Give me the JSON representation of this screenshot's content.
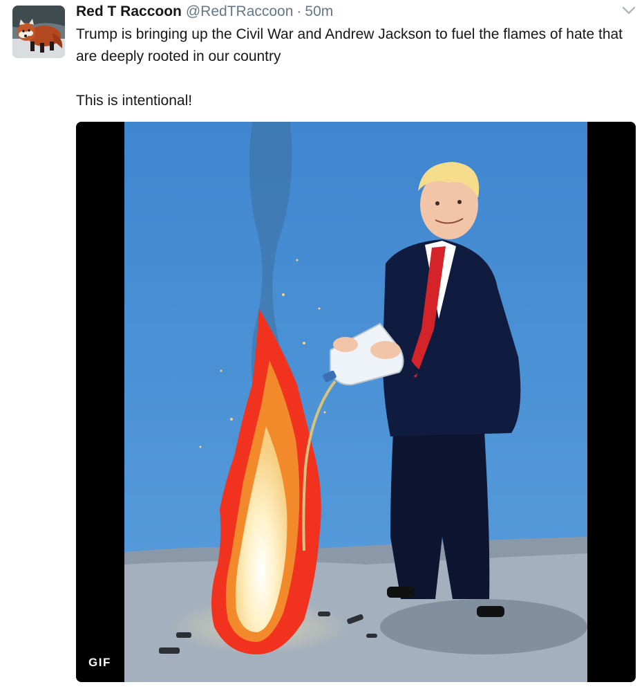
{
  "tweet": {
    "author": {
      "name": "Red T Raccoon",
      "handle": "@RedTRaccoon",
      "avatar_icon": "red-panda-avatar"
    },
    "separator": "·",
    "timestamp": "50m",
    "text_line_1": "Trump is bringing up the Civil War and Andrew Jackson to fuel the flames of hate that are deeply rooted in our country",
    "text_line_2": "This is intentional!",
    "menu_icon": "chevron-down-icon",
    "media": {
      "type": "gif",
      "badge": "GIF",
      "subject": "illustration of a man in a suit pouring fuel from a jug onto a fire"
    },
    "colors": {
      "name": "#14171a",
      "secondary": "#657786",
      "media_background": "#000000",
      "sky": "#4a8fd2"
    }
  }
}
